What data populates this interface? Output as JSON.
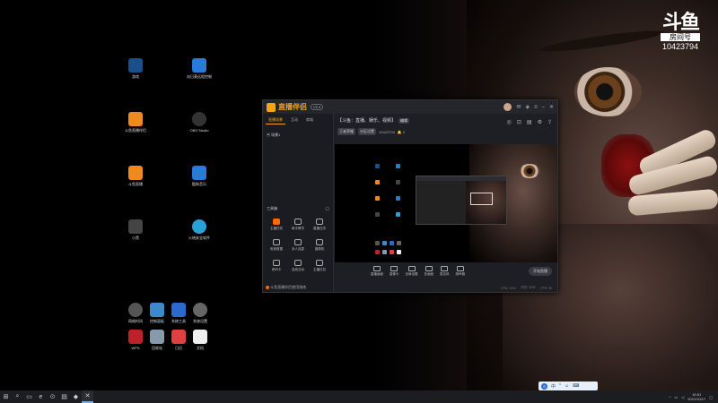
{
  "watermark": {
    "logo": "斗鱼",
    "sub": "房间号",
    "room": "10423794"
  },
  "desktop_icons": [
    {
      "name": "steam",
      "label": "游戏",
      "color": "#1b4f8a"
    },
    {
      "name": "sunlogin",
      "label": "向日葵远程控制",
      "color": "#2a7ad8"
    },
    {
      "name": "douyu-assistant",
      "label": "斗鱼直播伴侣",
      "color": "#f08a1c"
    },
    {
      "name": "obs",
      "label": "OBS Studio",
      "color": "#333333"
    },
    {
      "name": "douyu-live",
      "label": "斗鱼直播",
      "color": "#f08a1c"
    },
    {
      "name": "kugou",
      "label": "酷狗音乐",
      "color": "#2a7ad8"
    },
    {
      "name": "game-tool",
      "label": "小黑",
      "color": "#444444"
    },
    {
      "name": "edge",
      "label": "火绒安全软件",
      "color": "#2aa0d8"
    },
    {
      "name": "clock-app",
      "label": "网络时间",
      "color": "#555555"
    },
    {
      "name": "control-panel",
      "label": "控制面板",
      "color": "#3a8ad0"
    },
    {
      "name": "display-tool",
      "label": "系统工具",
      "color": "#2a6ad0"
    },
    {
      "name": "settings-app",
      "label": "系统设置",
      "color": "#666666"
    },
    {
      "name": "wps",
      "label": "WPS",
      "color": "#c0202a"
    },
    {
      "name": "recycle-bin",
      "label": "回收站",
      "color": "#8899aa"
    },
    {
      "name": "calendar",
      "label": "日历",
      "color": "#e04040"
    },
    {
      "name": "document",
      "label": "文档",
      "color": "#eeeeee"
    }
  ],
  "app": {
    "brand": "直播伴侣",
    "version": "V5 ▾",
    "tabs": [
      "直播场景",
      "互动",
      "商城"
    ],
    "scene_label": "▣ 场景1",
    "tools_title": "工具箱",
    "tools": [
      "主播任务",
      "新手教学",
      "直播日历",
      "电竞数据",
      "多人连麦",
      "摄像机",
      "房间卡",
      "连线互动",
      "主播红包"
    ],
    "footer_label": "斗鱼直播伴侣使用指南",
    "stream_title": "【斗鱼：直播、娱乐、视频】",
    "edit_label": "编辑",
    "meta": [
      "王者荣耀",
      "分区设置",
      "10423794",
      "🔔 0"
    ],
    "controls": [
      "直播画面",
      "摄像头",
      "全局设置",
      "多画面",
      "麦克风",
      "扬声器"
    ],
    "start_label": "开始直播",
    "status": [
      "CPU: 12%",
      "内存: 34%",
      "FPS: 30"
    ]
  },
  "ime": {
    "items": [
      "中",
      "°",
      "☺",
      "⌨"
    ]
  },
  "taskbar": {
    "items": [
      "⊞",
      "⌕",
      "▭",
      "e",
      "⊙",
      "▤",
      "◆",
      "✕"
    ],
    "time": "16:51",
    "date": "2021/10/17"
  }
}
